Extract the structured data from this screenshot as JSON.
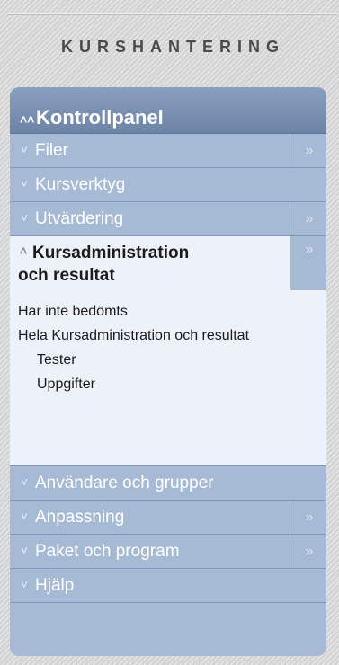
{
  "section_title": "KURSHANTERING",
  "panel": {
    "header": "Kontrollpanel",
    "items": [
      {
        "label": "Filer",
        "has_expand": true
      },
      {
        "label": "Kursverktyg",
        "has_expand": false
      },
      {
        "label": "Utvärdering",
        "has_expand": true
      }
    ],
    "expanded_item": {
      "label_line1": "Kursadministration",
      "label_line2": "och resultat",
      "links": [
        {
          "label": "Har inte bedömts"
        },
        {
          "label": "Hela Kursadministration och resultat"
        },
        {
          "label": "Tester"
        },
        {
          "label": "Uppgifter"
        }
      ]
    },
    "items_after": [
      {
        "label": "Användare och grupper",
        "has_expand": false
      },
      {
        "label": "Anpassning",
        "has_expand": true
      },
      {
        "label": "Paket och program",
        "has_expand": true
      },
      {
        "label": "Hjälp",
        "has_expand": false
      }
    ]
  },
  "icons": {
    "collapse": "double-chevron-up-icon",
    "expand": "double-chevron-down-icon",
    "open": "double-chevron-right-icon"
  },
  "colors": {
    "header": "#6d84a7",
    "row": "#a6bad6",
    "expanded_bg": "#ecf1fa",
    "title_text": "#4b4b4b"
  }
}
